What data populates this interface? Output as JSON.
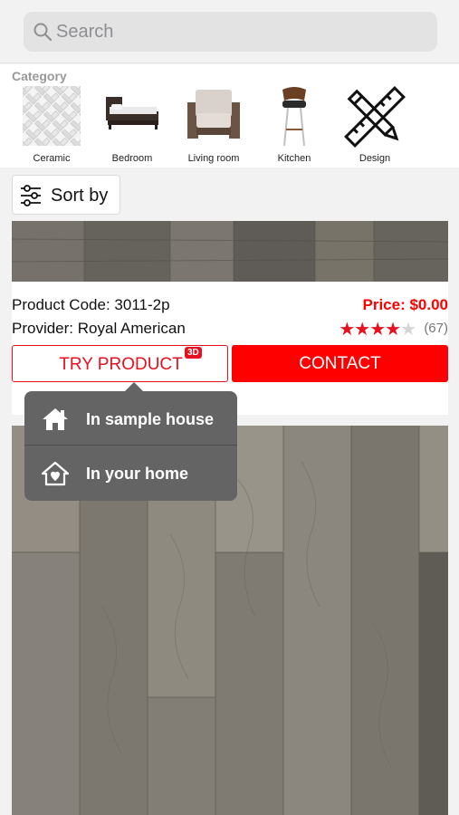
{
  "search": {
    "placeholder": "Search"
  },
  "category": {
    "label": "Category",
    "items": [
      {
        "name": "Ceramic",
        "icon": "ceramic-tile-icon"
      },
      {
        "name": "Bedroom",
        "icon": "bed-icon"
      },
      {
        "name": "Living room",
        "icon": "armchair-icon"
      },
      {
        "name": "Kitchen",
        "icon": "bar-stool-icon"
      },
      {
        "name": "Design",
        "icon": "design-tools-icon"
      }
    ]
  },
  "sort": {
    "label": "Sort by",
    "icon": "sliders-icon"
  },
  "product": {
    "code_label": "Product Code:",
    "code": "3011-2p",
    "provider_label": "Provider:",
    "provider": "Royal American",
    "price": "Price: $0.00",
    "rating": 4,
    "rating_max": 5,
    "review_count": "(67)",
    "try_label": "TRY PRODUCT",
    "badge": "3D",
    "contact_label": "CONTACT"
  },
  "popup": {
    "items": [
      {
        "label": "In sample house",
        "icon": "house-icon"
      },
      {
        "label": "In your home",
        "icon": "home-heart-icon"
      }
    ]
  },
  "colors": {
    "accent": "#e8101e",
    "contact_bg": "#ff0000",
    "popup_bg": "#646464"
  }
}
